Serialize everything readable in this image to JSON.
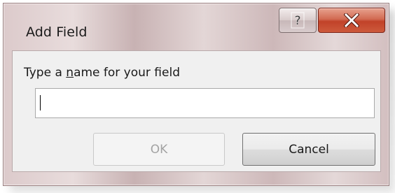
{
  "window": {
    "title": "Add Field"
  },
  "titlebar": {
    "help_glyph": "?",
    "close_glyph": "X"
  },
  "dialog": {
    "prompt_before": "Type a ",
    "prompt_mnemonic": "n",
    "prompt_after": "ame for your field",
    "name_value": ""
  },
  "buttons": {
    "ok_label": "OK",
    "cancel_label": "Cancel"
  },
  "icons": {
    "help": "help-icon",
    "close": "close-icon"
  },
  "colors": {
    "close_button": "#c14229",
    "ok_disabled_text": "#a3a3a3"
  }
}
